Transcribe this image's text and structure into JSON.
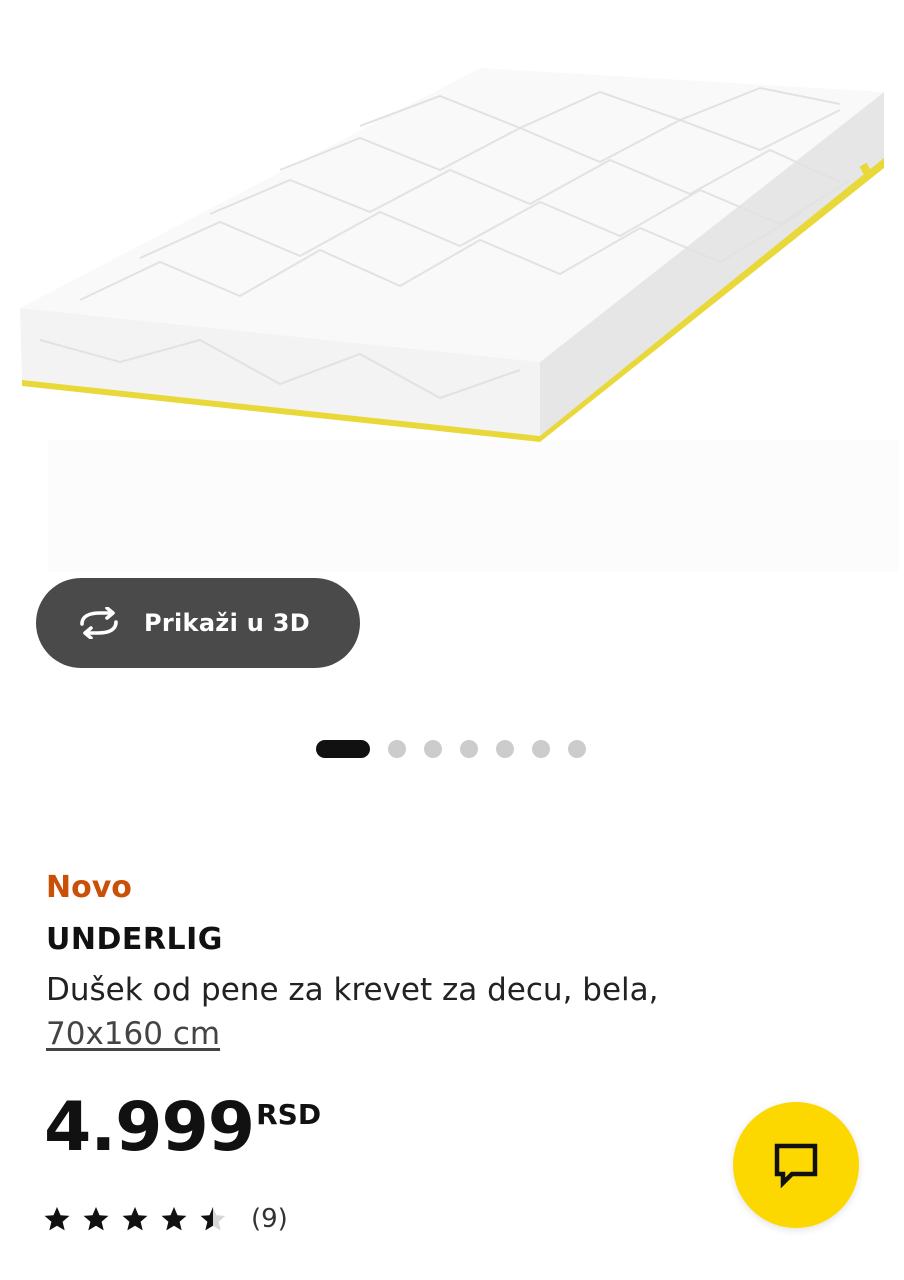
{
  "gallery": {
    "image_alt": "UNDERLIG foam mattress",
    "view_3d_label": "Prikaži u 3D",
    "dots": 7,
    "active_index": 0
  },
  "product": {
    "badge": "Novo",
    "name": "UNDERLIG",
    "description": "Dušek od pene za krevet za decu, bela,",
    "size": "70x160 cm",
    "price": "4.999",
    "currency": "RSD",
    "rating": 4.5,
    "review_count": "(9)"
  },
  "colors": {
    "badge": "#ca5008",
    "chat_button": "#fdd800",
    "view3d_bg": "#4a4a4a"
  },
  "icons": {
    "view3d": "rotate-arrows-icon",
    "chat": "chat-bubble-icon",
    "star": "star-icon"
  }
}
